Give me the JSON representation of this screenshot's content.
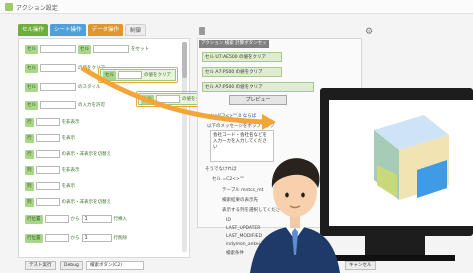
{
  "window": {
    "title": "アクション設定"
  },
  "tabs": [
    {
      "label": "セル操作"
    },
    {
      "label": "シート操作"
    },
    {
      "label": "データ操作"
    },
    {
      "label": "制御"
    }
  ],
  "left_rows": [
    {
      "chip": "セル",
      "label": "をセット"
    },
    {
      "chip": "セル",
      "label": "の値をクリア"
    },
    {
      "chip": "セル",
      "label": "のスタイル"
    },
    {
      "chip": "セル",
      "label": "の入力を許可"
    },
    {
      "chip": "行",
      "label": "を非表示"
    },
    {
      "chip": "行",
      "label": "を表示"
    },
    {
      "chip": "行",
      "label": "の表示・非表示を切替え"
    },
    {
      "chip": "列",
      "label": "を非表示"
    },
    {
      "chip": "列",
      "label": "を表示"
    },
    {
      "chip": "列",
      "label": "の表示・非表示を切替え"
    },
    {
      "chip": "行位置",
      "mid": "から",
      "value": "1",
      "label": "行挿入"
    },
    {
      "chip": "行位置",
      "mid": "から",
      "value": "1",
      "label": "行削除"
    }
  ],
  "float_rows": [
    {
      "chip": "セル",
      "label": "の値をクリア"
    },
    {
      "chip": "セル",
      "label": "の値をクリア"
    }
  ],
  "right_pane": {
    "header": "アクション 検索 計算ボタンセット",
    "items": [
      {
        "text": "セル U7:AE500 の値をクリア"
      },
      {
        "text": "セル A7:P500 の値をクリア"
      },
      {
        "text": "セル A7:P500 の値をクリア"
      }
    ],
    "preview_label": "プレビュー",
    "formula": "=len(C2<>\"\",0 ならば",
    "popup_title": "以下のメッセージをポップアップ",
    "popup_text": "会社コード・会社名などを入力ーカを入力してください",
    "else_label": "そうでなければ",
    "else_cond": "セル =C2<>\"\"",
    "table_label": "テーブル mntcs_mt",
    "search_label": "検索結果の表示先",
    "display_label": "表示する列を選択してください",
    "options": [
      {
        "label": "ID"
      },
      {
        "label": "LAST_UPDATER"
      },
      {
        "label": "LAST_MODIFIED"
      },
      {
        "label": "indymon_ankei"
      }
    ],
    "search_field_label": "検索条件"
  },
  "bottom": {
    "test_button": "テスト実行",
    "debug_button": "Debug",
    "select_value": "検索ボタン(C2)",
    "cancel_button": "キャンセル"
  },
  "colors": {
    "green_chip": "#a9d68a",
    "tab_green": "#6fae3b",
    "tab_blue": "#4f9fd8",
    "tab_orange": "#e1952a",
    "arrow_orange": "#f2a63a"
  },
  "icons": [
    "trash-icon",
    "gear-icon",
    "app-icon",
    "arrow-icon",
    "monitor-icon",
    "person-illustration",
    "cube-icon"
  ]
}
